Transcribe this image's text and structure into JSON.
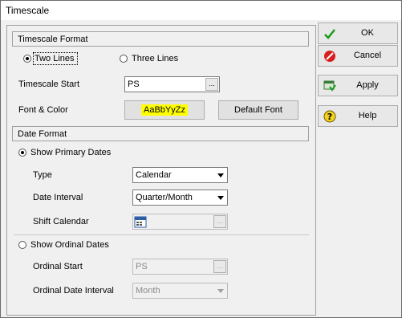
{
  "window": {
    "title": "Timescale"
  },
  "timescale_format": {
    "header": "Timescale Format",
    "two_lines_label": "Two Lines",
    "three_lines_label": "Three Lines",
    "selected": "Two Lines",
    "start_label": "Timescale Start",
    "start_value": "PS",
    "font_color_label": "Font & Color",
    "font_sample": "AaBbYyZz",
    "font_sample_bg": "#ffff00",
    "default_font_button": "Default Font"
  },
  "date_format": {
    "header": "Date Format",
    "show_primary_label": "Show Primary Dates",
    "show_primary_selected": true,
    "type_label": "Type",
    "type_value": "Calendar",
    "interval_label": "Date Interval",
    "interval_value": "Quarter/Month",
    "shift_label": "Shift Calendar",
    "show_ordinal_label": "Show Ordinal Dates",
    "show_ordinal_selected": false,
    "ordinal_start_label": "Ordinal Start",
    "ordinal_start_value": "PS",
    "ordinal_interval_label": "Ordinal Date Interval",
    "ordinal_interval_value": "Month"
  },
  "buttons": {
    "ok": "OK",
    "cancel": "Cancel",
    "apply": "Apply",
    "help": "Help"
  },
  "icons": {
    "ok": "checkmark-icon",
    "cancel": "cancel-icon",
    "apply": "apply-icon",
    "help": "help-icon",
    "calendar": "calendar-icon"
  },
  "colors": {
    "ok_check": "#1a9a1a",
    "cancel_red": "#d81e1e",
    "help_yellow": "#f2d21a"
  }
}
